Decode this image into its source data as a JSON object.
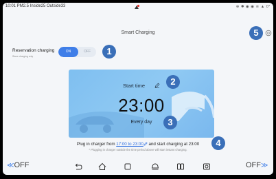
{
  "status_bar": {
    "left_text": "10:01 PM2.5 Inside25 Outside33",
    "right_text": "⊕ ✱ ◉ ◉ ≋ ▲ 0°"
  },
  "page": {
    "title": "Smart Charging"
  },
  "badges": [
    "1",
    "2",
    "3",
    "4",
    "5"
  ],
  "reservation": {
    "label": "Reservation charging",
    "sublabel": "Store charging only",
    "on_label": "ON",
    "off_label": "OFF",
    "state": "on"
  },
  "schedule_card": {
    "start_time_label": "Start time",
    "time_value": "23:00",
    "repeat_label": "Every day"
  },
  "info": {
    "prefix": "Plug in charger from ",
    "range_link": "17:00 to 23:00",
    "suffix": " and start charging at 23:00",
    "note": "* Plugging in charger outside the time period above will start instant charging."
  },
  "bottom_bar": {
    "left_label": "OFF",
    "right_label": "OFF",
    "left_arrow": "≪",
    "right_arrow": "≫",
    "icons": [
      "back-icon",
      "home-icon",
      "recent-apps-icon",
      "vehicle-icon",
      "grid-icon",
      "media-icon"
    ]
  },
  "colors": {
    "accent": "#3f7ee8",
    "badge": "#3a6fb8",
    "card": "#8cc7f2"
  }
}
